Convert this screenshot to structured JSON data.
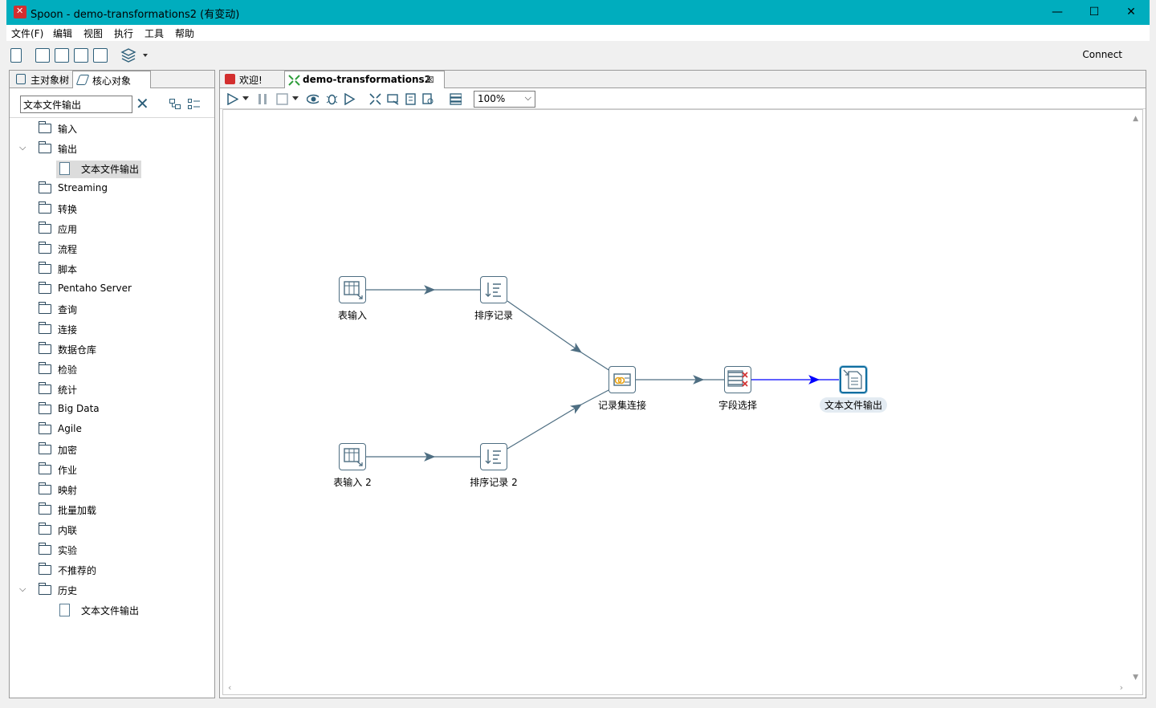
{
  "window": {
    "title": "Spoon - demo-transformations2 (有变动)",
    "controls": {
      "minimize": "—",
      "maximize": "☐",
      "close": "✕"
    }
  },
  "menu": [
    "文件(F)",
    "编辑",
    "视图",
    "执行",
    "工具",
    "帮助"
  ],
  "toolbar": {
    "connect_label": "Connect"
  },
  "left_panel": {
    "tabs": [
      "主对象树",
      "核心对象"
    ],
    "search_value": "文本文件输出",
    "tree": [
      {
        "label": "输入",
        "type": "folder",
        "expanded": false
      },
      {
        "label": "输出",
        "type": "folder",
        "expanded": true
      },
      {
        "label": "文本文件输出",
        "type": "step",
        "selected": true
      },
      {
        "label": "Streaming",
        "type": "folder"
      },
      {
        "label": "转换",
        "type": "folder"
      },
      {
        "label": "应用",
        "type": "folder"
      },
      {
        "label": "流程",
        "type": "folder"
      },
      {
        "label": "脚本",
        "type": "folder"
      },
      {
        "label": "Pentaho Server",
        "type": "folder"
      },
      {
        "label": "查询",
        "type": "folder"
      },
      {
        "label": "连接",
        "type": "folder"
      },
      {
        "label": "数据仓库",
        "type": "folder"
      },
      {
        "label": "检验",
        "type": "folder"
      },
      {
        "label": "统计",
        "type": "folder"
      },
      {
        "label": "Big Data",
        "type": "folder"
      },
      {
        "label": "Agile",
        "type": "folder"
      },
      {
        "label": "加密",
        "type": "folder"
      },
      {
        "label": "作业",
        "type": "folder"
      },
      {
        "label": "映射",
        "type": "folder"
      },
      {
        "label": "批量加载",
        "type": "folder"
      },
      {
        "label": "内联",
        "type": "folder"
      },
      {
        "label": "实验",
        "type": "folder"
      },
      {
        "label": "不推荐的",
        "type": "folder"
      },
      {
        "label": "历史",
        "type": "folder",
        "expanded": true
      },
      {
        "label": "文本文件输出",
        "type": "step"
      }
    ]
  },
  "editor": {
    "tabs": [
      "欢迎!",
      "demo-transformations2"
    ],
    "zoom": "100%",
    "steps": {
      "table_input_1": "表输入",
      "sort_1": "排序记录",
      "merge_join": "记录集连接",
      "select_values": "字段选择",
      "text_output": "文本文件输出",
      "table_input_2": "表输入 2",
      "sort_2": "排序记录 2"
    }
  },
  "colors": {
    "titlebar": "#00adbe",
    "hop": "#4e6e82",
    "selected_hop": "#0000ff"
  }
}
